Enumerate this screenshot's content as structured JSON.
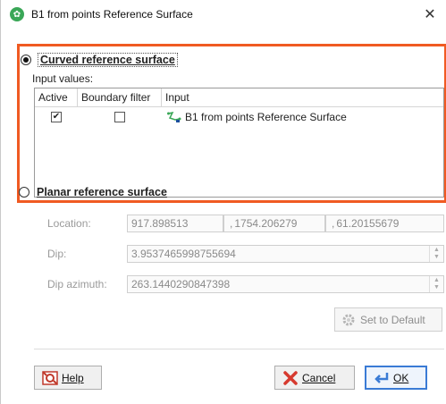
{
  "window": {
    "title": "B1 from points Reference Surface",
    "close_glyph": "✕"
  },
  "curved": {
    "label": "Curved reference surface",
    "selected": true,
    "input_values_label": "Input values:",
    "columns": [
      "Active",
      "Boundary filter",
      "Input"
    ],
    "rows": [
      {
        "active": true,
        "boundary_filter": false,
        "input": "B1 from points Reference Surface"
      }
    ]
  },
  "planar": {
    "label": "Planar reference surface",
    "selected": false,
    "location_label": "Location:",
    "location_x": "917.898513",
    "location_y": "1754.206279",
    "location_z": "61.20155679",
    "location_sep": ",",
    "dip_label": "Dip:",
    "dip_value": "3.9537465998755694",
    "dip_azimuth_label": "Dip azimuth:",
    "dip_azimuth_value": "263.1440290847398",
    "set_default_label": "Set to Default"
  },
  "buttons": {
    "help": "Help",
    "cancel": "Cancel",
    "ok": "OK"
  },
  "colors": {
    "highlight": "#f05a22",
    "ok_border": "#3a7bd5",
    "app_icon": "#3aa757"
  },
  "icons": {
    "app": "app-logo-icon",
    "surface": "surface-icon",
    "gear": "gear-icon",
    "help": "help-icon",
    "cancel": "cancel-icon",
    "ok": "return-icon"
  }
}
